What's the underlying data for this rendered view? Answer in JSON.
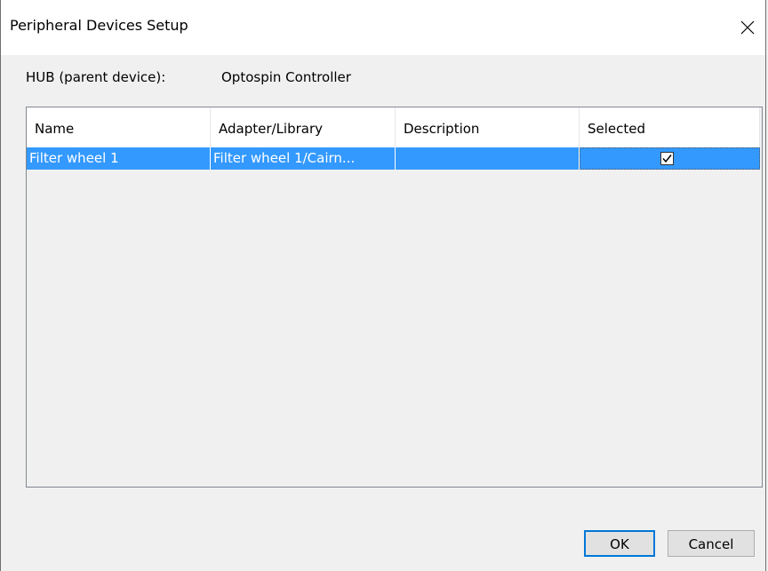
{
  "window": {
    "title": "Peripheral Devices Setup",
    "close_icon": "close-icon"
  },
  "hub": {
    "label": "HUB (parent device):",
    "value": "Optospin Controller"
  },
  "table": {
    "columns": [
      "Name",
      "Adapter/Library",
      "Description",
      "Selected"
    ],
    "rows": [
      {
        "name": "Filter wheel 1",
        "adapter": "Filter wheel 1/Cairn...",
        "description": "",
        "selected": true
      }
    ],
    "selection_color": "#3399ff"
  },
  "buttons": {
    "ok": "OK",
    "cancel": "Cancel"
  }
}
